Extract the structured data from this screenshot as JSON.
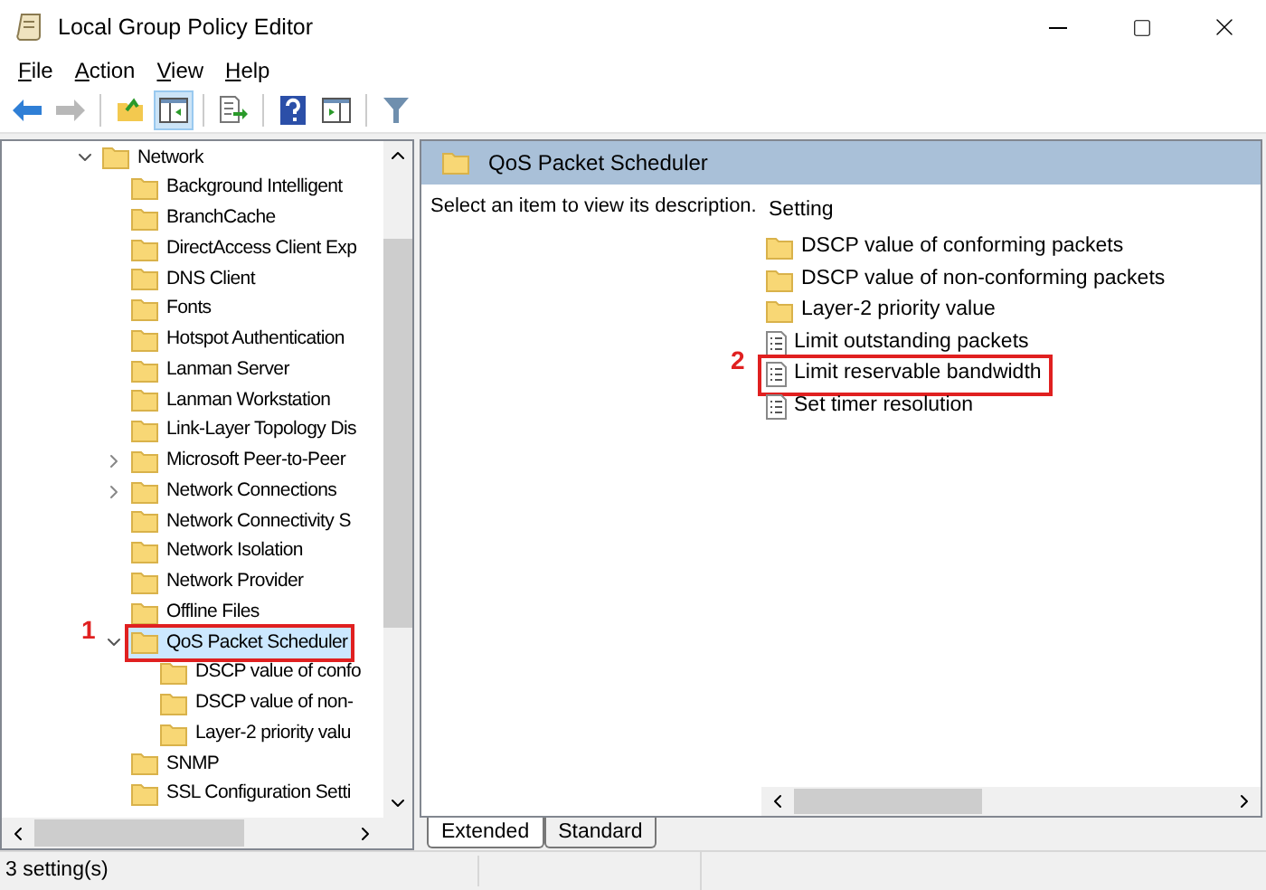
{
  "window": {
    "title": "Local Group Policy Editor"
  },
  "menu": [
    "File",
    "Action",
    "View",
    "Help"
  ],
  "toolbar": [
    {
      "kind": "back",
      "disabled": false,
      "selected": false
    },
    {
      "kind": "forward",
      "disabled": true,
      "selected": false
    },
    {
      "kind": "up",
      "disabled": false,
      "selected": false
    },
    {
      "kind": "tree",
      "disabled": false,
      "selected": true
    },
    {
      "kind": "export",
      "disabled": false,
      "selected": false
    },
    {
      "kind": "help",
      "disabled": false,
      "selected": false
    },
    {
      "kind": "pane",
      "disabled": false,
      "selected": false
    },
    {
      "kind": "filter",
      "disabled": false,
      "selected": false
    }
  ],
  "tree": {
    "items": [
      {
        "label": "Network",
        "expanded": true,
        "selected": false,
        "children": [
          {
            "label": "Background Intelligent",
            "selected": false
          },
          {
            "label": "BranchCache",
            "selected": false
          },
          {
            "label": "DirectAccess Client Exp",
            "selected": false
          },
          {
            "label": "DNS Client",
            "selected": false
          },
          {
            "label": "Fonts",
            "selected": false
          },
          {
            "label": "Hotspot Authentication",
            "selected": false
          },
          {
            "label": "Lanman Server",
            "selected": false
          },
          {
            "label": "Lanman Workstation",
            "selected": false
          },
          {
            "label": "Link-Layer Topology Dis",
            "selected": false
          },
          {
            "label": "Microsoft Peer-to-Peer",
            "expanded": false,
            "selected": false
          },
          {
            "label": "Network Connections",
            "expanded": false,
            "selected": false
          },
          {
            "label": "Network Connectivity S",
            "selected": false
          },
          {
            "label": "Network Isolation",
            "selected": false
          },
          {
            "label": "Network Provider",
            "selected": false
          },
          {
            "label": "Offline Files",
            "selected": false
          },
          {
            "label": "QoS Packet Scheduler",
            "expanded": true,
            "selected": true,
            "marker": "1",
            "children": [
              {
                "label": "DSCP value of confo",
                "selected": false
              },
              {
                "label": "DSCP value of non-",
                "selected": false
              },
              {
                "label": "Layer-2 priority valu",
                "selected": false
              }
            ]
          },
          {
            "label": "SNMP",
            "selected": false
          },
          {
            "label": "SSL Configuration Setti",
            "selected": false
          }
        ]
      }
    ]
  },
  "details": {
    "header": "QoS Packet Scheduler",
    "description": "Select an item to view its description.",
    "column": "Setting",
    "settings": [
      {
        "label": "DSCP value of conforming packets",
        "kind": "folder"
      },
      {
        "label": "DSCP value of non-conforming packets",
        "kind": "folder"
      },
      {
        "label": "Layer-2 priority value",
        "kind": "folder"
      },
      {
        "label": "Limit outstanding packets",
        "kind": "policy"
      },
      {
        "label": "Limit reservable bandwidth",
        "kind": "policy",
        "marker": "2"
      },
      {
        "label": "Set timer resolution",
        "kind": "policy"
      }
    ],
    "tabs": [
      {
        "label": "Extended",
        "selected": true
      },
      {
        "label": "Standard",
        "selected": false
      }
    ]
  },
  "status_bar": "3 setting(s)"
}
